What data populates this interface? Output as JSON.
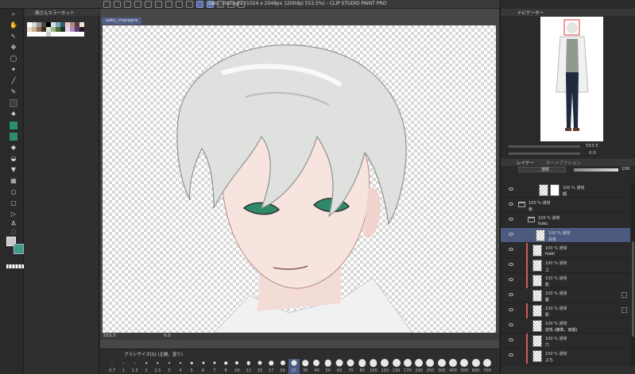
{
  "window": {
    "title": "saku_charagra (1024 x 2048px 1200dpi 553.5%)  - CLIP STUDIO PAINT PRO"
  },
  "canvas": {
    "tab_label": "saku_charagra",
    "status_zoom": "553.5",
    "status_angle": "0.0"
  },
  "color_set": {
    "title": "焼さんカラーセット",
    "swatches": [
      "#ffffff",
      "#d9d9d9",
      "#9a9a9a",
      "#4a4a4a",
      "#000000",
      "#cfe3ef",
      "#7fa6b8",
      "#2d5c6e",
      "#e8c7c7",
      "#b48a8a",
      "#5e3b3b",
      "#f4e5d6",
      "#e9d9c8",
      "#c9b096",
      "#8d6e52",
      "#3b2a1e",
      "#dfe8d5",
      "#9fb58a",
      "#4f6b3d",
      "#1f3322",
      "#e6d3ec",
      "#a98cb8",
      "#5b3f6b",
      "#221a2a",
      "#ffffff",
      "#ffffff",
      "#ffffff",
      "#ffffff",
      "#cccccc",
      "#ffffff",
      "#ffffff",
      "#ffffff",
      "#ffffff",
      "#ffffff",
      "#ffffff",
      "#ffffff"
    ]
  },
  "brush_size": {
    "label": "ブラシサイズ[S]  (主線、塗り)",
    "sizes": [
      {
        "v": "0.7",
        "d": 1
      },
      {
        "v": "1",
        "d": 1
      },
      {
        "v": "1.5",
        "d": 1
      },
      {
        "v": "2",
        "d": 1.5
      },
      {
        "v": "2.5",
        "d": 1.5
      },
      {
        "v": "3",
        "d": 2
      },
      {
        "v": "4",
        "d": 2
      },
      {
        "v": "5",
        "d": 2.5
      },
      {
        "v": "6",
        "d": 3
      },
      {
        "v": "7",
        "d": 3
      },
      {
        "v": "8",
        "d": 3.5
      },
      {
        "v": "10",
        "d": 4
      },
      {
        "v": "12",
        "d": 4.5
      },
      {
        "v": "15",
        "d": 5
      },
      {
        "v": "17",
        "d": 5.5
      },
      {
        "v": "20",
        "d": 6
      },
      {
        "v": "25",
        "d": 7
      },
      {
        "v": "30",
        "d": 7.5
      },
      {
        "v": "40",
        "d": 8
      },
      {
        "v": "50",
        "d": 8.5
      },
      {
        "v": "60",
        "d": 9
      },
      {
        "v": "70",
        "d": 9
      },
      {
        "v": "80",
        "d": 9.5
      },
      {
        "v": "100",
        "d": 9.5
      },
      {
        "v": "120",
        "d": 10
      },
      {
        "v": "150",
        "d": 10
      },
      {
        "v": "170",
        "d": 10
      },
      {
        "v": "200",
        "d": 10
      },
      {
        "v": "250",
        "d": 10
      },
      {
        "v": "300",
        "d": 10
      },
      {
        "v": "400",
        "d": 10
      },
      {
        "v": "500",
        "d": 10
      },
      {
        "v": "600",
        "d": 10
      },
      {
        "v": "700",
        "d": 10
      }
    ],
    "selected": "25"
  },
  "navigator": {
    "title": "ナビゲーター",
    "zoom": "553.5",
    "angle": "0.0"
  },
  "layer_panel": {
    "tab_layer": "レイヤー",
    "tab_auto": "オートアクション",
    "blend_mode": "通常",
    "opacity": "100",
    "layers": [
      {
        "opacity": "100 %  通常",
        "name": "顔",
        "indent": 48,
        "type": "layer",
        "clip": false,
        "sel": false,
        "mask": true
      },
      {
        "opacity": "100 %  通常",
        "name": "色",
        "indent": 22,
        "type": "folder",
        "clip": false,
        "sel": false
      },
      {
        "opacity": "100 %  通常",
        "name": "huku",
        "indent": 34,
        "type": "folder",
        "clip": false,
        "sel": false
      },
      {
        "opacity": "100 %  通常",
        "name": "白衣",
        "indent": 44,
        "type": "layer",
        "clip": false,
        "sel": true
      },
      {
        "opacity": "100 %  通常",
        "name": "hiaki",
        "indent": 40,
        "type": "layer",
        "clip": true,
        "sel": false
      },
      {
        "opacity": "100 %  通常",
        "name": "上",
        "indent": 40,
        "type": "layer",
        "clip": true,
        "sel": false
      },
      {
        "opacity": "100 %  通常",
        "name": "影",
        "indent": 40,
        "type": "layer",
        "clip": true,
        "sel": false
      },
      {
        "opacity": "100 %  通常",
        "name": "髪",
        "indent": 40,
        "type": "layer",
        "clip": false,
        "sel": false,
        "fx": true
      },
      {
        "opacity": "100 %  通常",
        "name": "影",
        "indent": 40,
        "type": "layer",
        "clip": true,
        "sel": false,
        "fx": true
      },
      {
        "opacity": "100 %  通常",
        "name": "前毛 (横準、高額)",
        "indent": 40,
        "type": "layer",
        "clip": false,
        "sel": false
      },
      {
        "opacity": "100 %  通常",
        "name": "穴",
        "indent": 40,
        "type": "layer",
        "clip": true,
        "sel": false
      },
      {
        "opacity": "100 %  通常",
        "name": "ぶち",
        "indent": 40,
        "type": "layer",
        "clip": true,
        "sel": false
      }
    ]
  }
}
